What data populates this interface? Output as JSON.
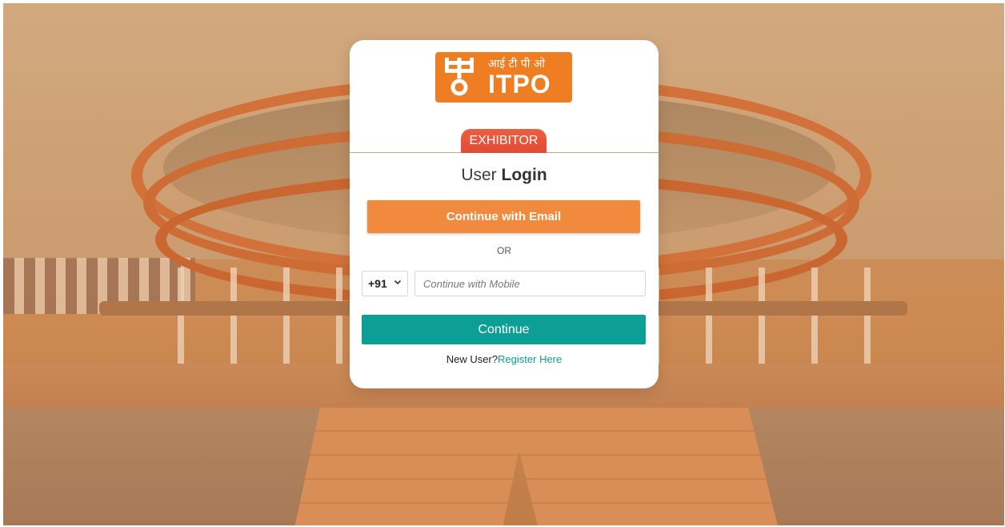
{
  "logo": {
    "hindi_text": "आई टी पी ओ",
    "brand_text": "ITPO",
    "brand_color": "#ef7d22"
  },
  "role_tab": {
    "label": "EXHIBITOR",
    "color": "#e24a34"
  },
  "title": {
    "prefix": "User ",
    "bold": "Login"
  },
  "email_button": {
    "label": "Continue with Email",
    "color": "#f28a3e"
  },
  "separator": {
    "label": "OR"
  },
  "country_code": {
    "selected": "+91"
  },
  "mobile_input": {
    "value": "",
    "placeholder": "Continue with Mobile"
  },
  "continue_button": {
    "label": "Continue",
    "color": "#0d9e95"
  },
  "register": {
    "prompt": "New User?",
    "link_label": "Register Here"
  },
  "icons": {
    "dropdown": "chevron-down-icon"
  }
}
